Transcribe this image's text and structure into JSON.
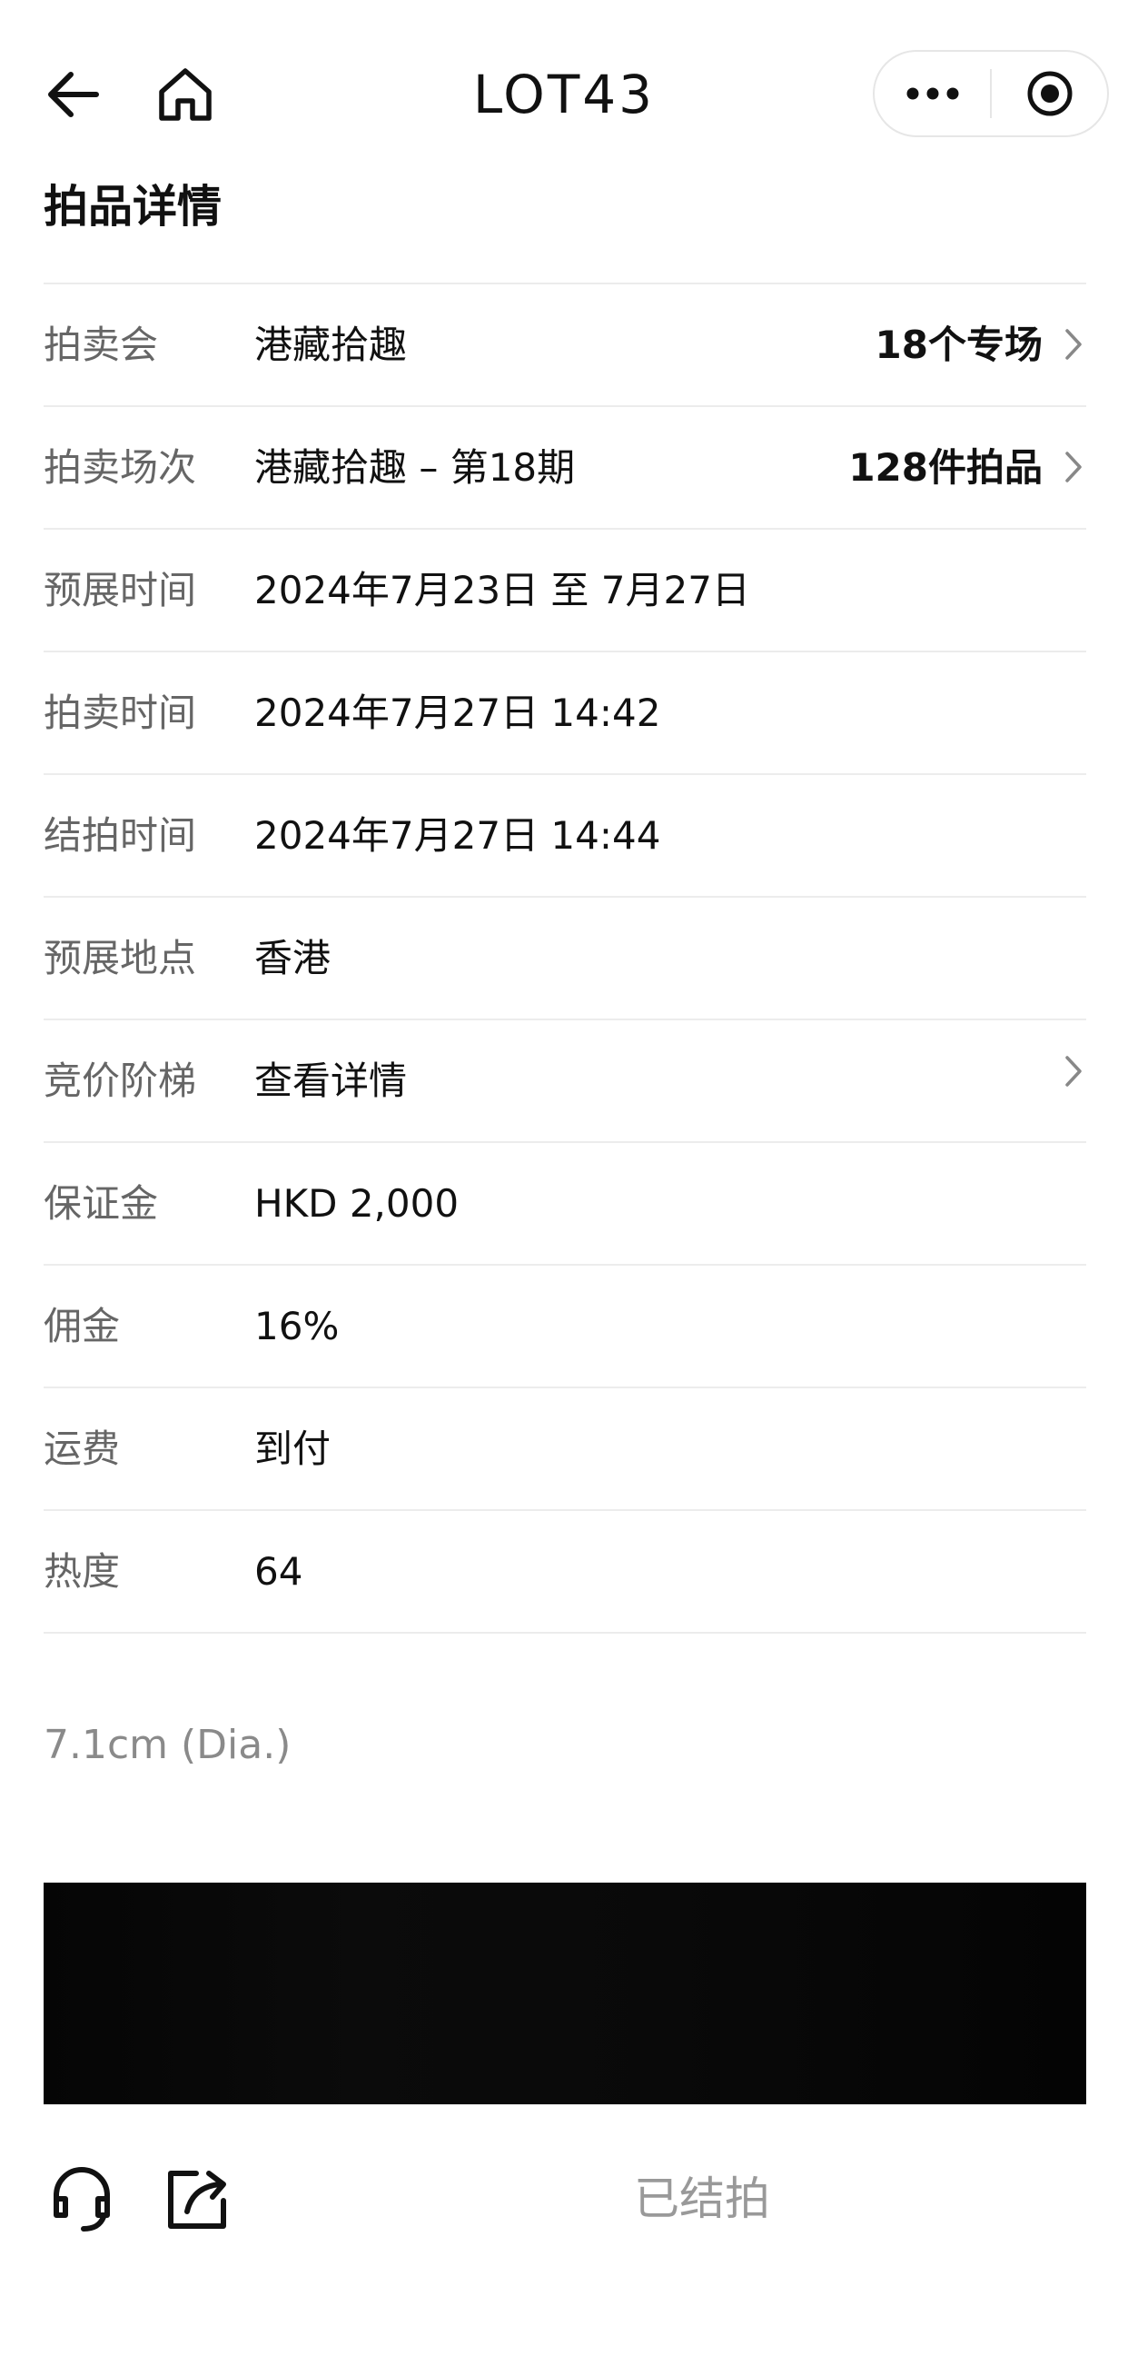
{
  "nav": {
    "title": "LOT43",
    "back_icon": "arrow-left-icon",
    "home_icon": "home-icon",
    "more_icon": "more-dots-icon",
    "close_icon": "target-circle-icon"
  },
  "section": {
    "title": "拍品详情"
  },
  "details": [
    {
      "label": "拍卖会",
      "value": "港藏拾趣",
      "extra": "18个专场",
      "chevron": true
    },
    {
      "label": "拍卖场次",
      "value": "港藏拾趣 – 第18期",
      "extra": "128件拍品",
      "chevron": true
    },
    {
      "label": "预展时间",
      "value": "2024年7月23日 至 7月27日"
    },
    {
      "label": "拍卖时间",
      "value": "2024年7月27日 14:42"
    },
    {
      "label": "结拍时间",
      "value": "2024年7月27日 14:44"
    },
    {
      "label": "预展地点",
      "value": "香港"
    },
    {
      "label": "竞价阶梯",
      "value": "查看详情",
      "chevron": true
    },
    {
      "label": "保证金",
      "value": "HKD 2,000"
    },
    {
      "label": "佣金",
      "value": "16%"
    },
    {
      "label": "运费",
      "value": "到付"
    },
    {
      "label": "热度",
      "value": "64"
    }
  ],
  "lot": {
    "description": "7.1cm (Dia.)"
  },
  "bottom": {
    "service_icon": "headset-icon",
    "share_icon": "share-icon",
    "status": "已结拍"
  },
  "colors": {
    "label": "#666666",
    "value": "#111111",
    "divider": "#ececec",
    "muted": "#999999"
  }
}
